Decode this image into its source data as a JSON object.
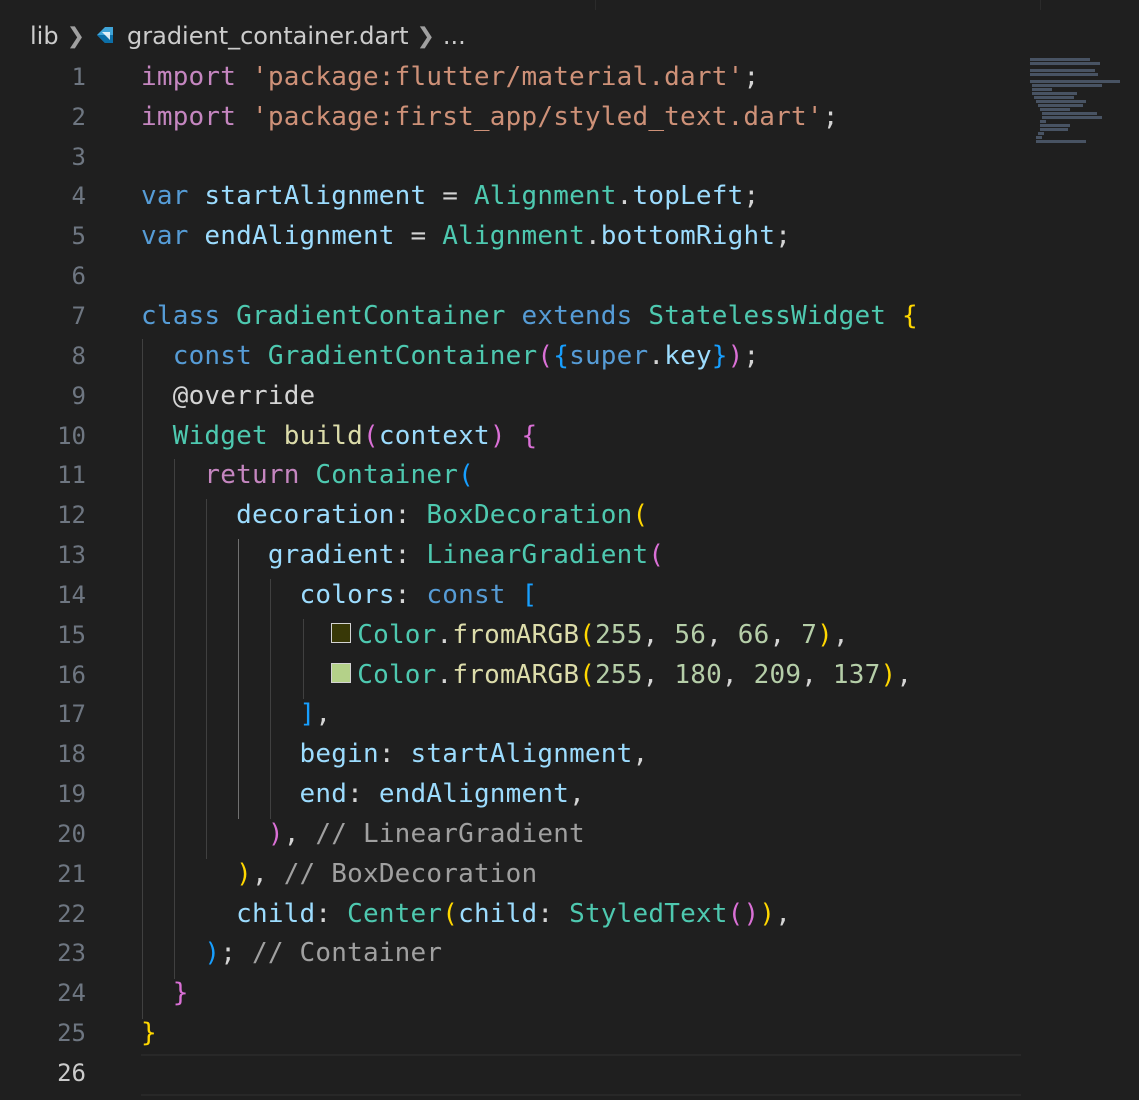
{
  "breadcrumb": {
    "folder": "lib",
    "file": "gradient_container.dart",
    "more": "..."
  },
  "icons": {
    "file_icon": "dart-file-icon",
    "separator": "chevron-right-icon"
  },
  "colors": {
    "swatch1": "#383807",
    "swatch2": "#b4d189"
  },
  "active_line": 26,
  "lines": [
    {
      "n": "1"
    },
    {
      "n": "2"
    },
    {
      "n": "3"
    },
    {
      "n": "4"
    },
    {
      "n": "5"
    },
    {
      "n": "6"
    },
    {
      "n": "7"
    },
    {
      "n": "8"
    },
    {
      "n": "9"
    },
    {
      "n": "10"
    },
    {
      "n": "11"
    },
    {
      "n": "12"
    },
    {
      "n": "13"
    },
    {
      "n": "14"
    },
    {
      "n": "15"
    },
    {
      "n": "16"
    },
    {
      "n": "17"
    },
    {
      "n": "18"
    },
    {
      "n": "19"
    },
    {
      "n": "20"
    },
    {
      "n": "21"
    },
    {
      "n": "22"
    },
    {
      "n": "23"
    },
    {
      "n": "24"
    },
    {
      "n": "25"
    },
    {
      "n": "26"
    }
  ],
  "code": {
    "l1": "import 'package:flutter/material.dart';",
    "l2": "import 'package:first_app/styled_text.dart';",
    "l4_kw": "var",
    "l4_id": "startAlignment",
    "l4_ty": "Alignment",
    "l4_prop": "topLeft",
    "l5_kw": "var",
    "l5_id": "endAlignment",
    "l5_ty": "Alignment",
    "l5_prop": "bottomRight",
    "l7_class": "class",
    "l7_name": "GradientContainer",
    "l7_extends": "extends",
    "l7_base": "StatelessWidget",
    "l8_const": "const",
    "l8_name": "GradientContainer",
    "l8_super": "super",
    "l8_key": "key",
    "l9_anno": "@override",
    "l10_type": "Widget",
    "l10_fn": "build",
    "l10_param": "context",
    "l11_return": "return",
    "l11_type": "Container",
    "l12_prop": "decoration",
    "l12_type": "BoxDecoration",
    "l13_prop": "gradient",
    "l13_type": "LinearGradient",
    "l14_prop": "colors",
    "l14_const": "const",
    "l15_type": "Color",
    "l15_fn": "fromARGB",
    "l15_args": [
      "255",
      "56",
      "66",
      "7"
    ],
    "l16_type": "Color",
    "l16_fn": "fromARGB",
    "l16_args": [
      "255",
      "180",
      "209",
      "137"
    ],
    "l18_prop": "begin",
    "l18_val": "startAlignment",
    "l19_prop": "end",
    "l19_val": "endAlignment",
    "l20_comment": "// LinearGradient",
    "l21_comment": "// BoxDecoration",
    "l22_prop": "child",
    "l22_type": "Center",
    "l22_prop2": "child",
    "l22_type2": "StyledText",
    "l23_comment": "// Container"
  }
}
